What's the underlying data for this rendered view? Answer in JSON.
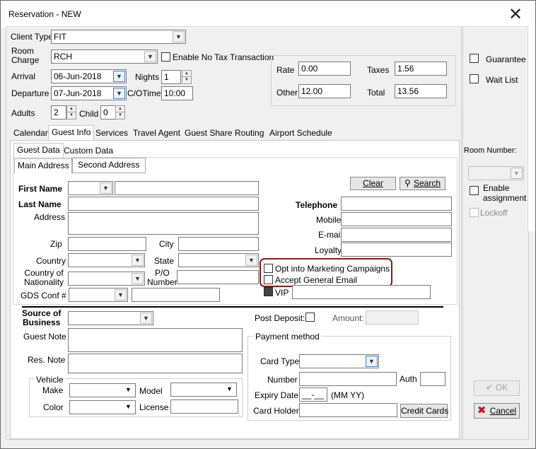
{
  "window": {
    "title": "Reservation - NEW",
    "close_glyph": "✕"
  },
  "header": {
    "client_type_label": "Client Type",
    "client_type_value": "FIT",
    "room_charge_label": "Room\nCharge",
    "room_charge_value": "RCH",
    "no_tax_label": "Enable No Tax Transaction",
    "arrival_label": "Arrival",
    "arrival_value": "06-Jun-2018",
    "nights_label": "Nights",
    "nights_value": "1",
    "departure_label": "Departure",
    "departure_value": "07-Jun-2018",
    "co_time_label": "C/OTime",
    "co_time_value": "10:00",
    "adults_label": "Adults",
    "adults_value": "2",
    "child_label": "Child",
    "child_value": "0"
  },
  "rates": {
    "rate_label": "Rate",
    "rate_value": "0.00",
    "taxes_label": "Taxes",
    "taxes_value": "1.56",
    "other_label": "Other",
    "other_value": "12.00",
    "total_label": "Total",
    "total_value": "13.56"
  },
  "side": {
    "guarantee_label": "Guarantee",
    "waitlist_label": "Wait List",
    "room_number_label": "Room Number:",
    "enable_assignment_label": "Enable\nassignment",
    "lockoff_label": "Lockoff",
    "ok_label": "OK",
    "cancel_label": "Cancel"
  },
  "tabs": [
    "Calendar",
    "Guest Info",
    "Services",
    "Travel Agent",
    "Guest Share",
    "Routing",
    "Airport Schedule"
  ],
  "subtabs": [
    "Guest Data",
    "Custom Data"
  ],
  "addrtabs": [
    "Main Address",
    "Second Address"
  ],
  "guest": {
    "clear_label": "Clear",
    "search_label": "Search",
    "first_name_label": "First Name",
    "last_name_label": "Last Name",
    "address_label": "Address",
    "zip_label": "Zip",
    "city_label": "City",
    "country_label": "Country",
    "state_label": "State",
    "country_nat_label": "Country of\nNationality",
    "po_label": "P/O\nNumber",
    "gds_label": "GDS Conf #",
    "telephone_label": "Telephone",
    "mobile_label": "Mobile",
    "email_label": "E-mail",
    "loyalty_label": "Loyalty",
    "opt_marketing_label": "Opt into Marketing Campaigns",
    "accept_email_label": "Accept General Email",
    "vip_label": "VIP"
  },
  "lower": {
    "source_label": "Source of\nBusiness",
    "post_deposit_label": "Post Deposit:",
    "amount_label": "Amount:",
    "guest_note_label": "Guest Note",
    "res_note_label": "Res. Note",
    "vehicle_label": "Vehicle",
    "make_label": "Make",
    "model_label": "Model",
    "color_label": "Color",
    "license_label": "License",
    "payment_label": "Payment method",
    "card_type_label": "Card Type",
    "number_label": "Number",
    "auth_label": "Auth",
    "expiry_label": "Expiry Date",
    "expiry_value": "__-__",
    "expiry_hint": "(MM YY)",
    "card_holder_label": "Card Holder",
    "credit_cards_label": "Credit Cards"
  },
  "colors": {
    "callout": "#8b1a1a",
    "accent": "#3d7bd4",
    "cancel_x": "#c0141c"
  }
}
